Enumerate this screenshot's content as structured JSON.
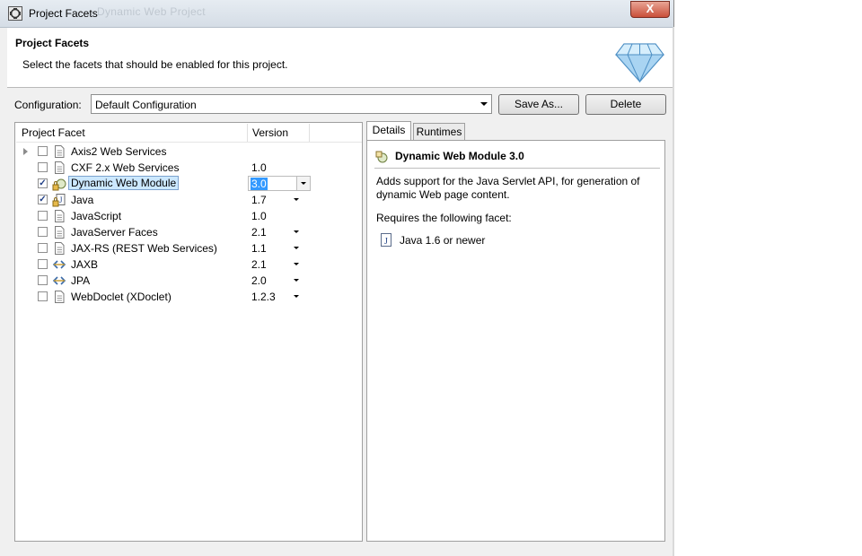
{
  "window": {
    "title": "Project Facets",
    "ghost_title": "Dynamic Web Project",
    "close_label": "X"
  },
  "header": {
    "title": "Project Facets",
    "description": "Select the facets that should be enabled for this project."
  },
  "configuration": {
    "label": "Configuration:",
    "selected": "Default Configuration",
    "save_as_label": "Save As...",
    "delete_label": "Delete"
  },
  "table": {
    "columns": [
      "Project Facet",
      "Version"
    ],
    "rows": [
      {
        "name": "Axis2 Web Services",
        "version": "",
        "checked": false,
        "expandable": true,
        "icon": "page-icon",
        "has_dropdown": false
      },
      {
        "name": "CXF 2.x Web Services",
        "version": "1.0",
        "checked": false,
        "icon": "page-icon",
        "has_dropdown": false
      },
      {
        "name": "Dynamic Web Module",
        "version": "3.0",
        "checked": true,
        "icon": "locked-web-module-icon",
        "selected": true
      },
      {
        "name": "Java",
        "version": "1.7",
        "checked": true,
        "icon": "locked-java-icon",
        "has_dropdown": true
      },
      {
        "name": "JavaScript",
        "version": "1.0",
        "checked": false,
        "icon": "page-icon",
        "has_dropdown": false
      },
      {
        "name": "JavaServer Faces",
        "version": "2.1",
        "checked": false,
        "icon": "page-icon",
        "has_dropdown": true
      },
      {
        "name": "JAX-RS (REST Web Services)",
        "version": "1.1",
        "checked": false,
        "icon": "page-icon",
        "has_dropdown": true
      },
      {
        "name": "JAXB",
        "version": "2.1",
        "checked": false,
        "icon": "arrows-icon",
        "has_dropdown": true
      },
      {
        "name": "JPA",
        "version": "2.0",
        "checked": false,
        "icon": "arrows-icon",
        "has_dropdown": true
      },
      {
        "name": "WebDoclet (XDoclet)",
        "version": "1.2.3",
        "checked": false,
        "icon": "page-icon",
        "has_dropdown": true
      }
    ]
  },
  "tabs": [
    {
      "label": "Details",
      "active": true
    },
    {
      "label": "Runtimes",
      "active": false
    }
  ],
  "details": {
    "title": "Dynamic Web Module 3.0",
    "description": "Adds support for the Java Servlet API, for generation of dynamic Web page content.",
    "requires_label": "Requires the following facet:",
    "requirement": "Java 1.6 or newer"
  }
}
